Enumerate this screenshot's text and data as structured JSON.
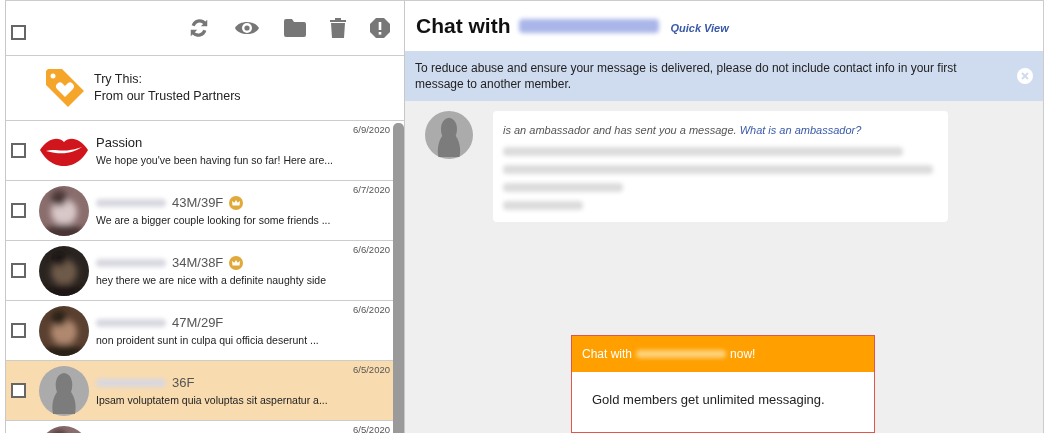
{
  "toolbar": {
    "select_all": {
      "checked": false
    }
  },
  "promo": {
    "title": "Try This:",
    "subtitle": "From our Trusted Partners"
  },
  "conversations": [
    {
      "kind": "lips",
      "name": "Passion",
      "name_blurred": false,
      "gold": false,
      "preview": "We hope you've been having fun so far! Here are...",
      "date": "6/9/2020",
      "checked": false,
      "selected": false
    },
    {
      "name_blurred": true,
      "info": "43M/39F",
      "gold": true,
      "preview": "We are a bigger couple looking for some friends ...",
      "date": "6/7/2020",
      "checked": false,
      "selected": false
    },
    {
      "name_blurred": true,
      "info": "34M/38F",
      "gold": true,
      "preview": "hey there we are nice with a definite naughty side",
      "date": "6/6/2020",
      "checked": false,
      "selected": false
    },
    {
      "name_blurred": true,
      "info": "47M/29F",
      "gold": false,
      "preview": "non proident sunt in culpa qui officia deserunt ...",
      "date": "6/6/2020",
      "checked": false,
      "selected": false
    },
    {
      "kind": "silhouette",
      "name_blurred": true,
      "info": "36F",
      "gold": false,
      "preview": "Ipsam voluptatem quia voluptas sit aspernatur a...",
      "date": "6/5/2020",
      "checked": false,
      "selected": true
    },
    {
      "date": "6/5/2020",
      "selected": false
    }
  ],
  "chat": {
    "title": "Chat with",
    "name_blurred": true,
    "quick_view": "Quick View",
    "notice": "To reduce abuse and ensure your message is delivered, please do not include contact info in your first message to another member.",
    "message": {
      "intro": "is an ambassador and has sent you a message.",
      "link": "What is an ambassador?",
      "body_blurred": true
    },
    "upsell": {
      "title_start": "Chat with",
      "title_end": "now!",
      "body": "Gold members get unlimited messaging."
    }
  }
}
